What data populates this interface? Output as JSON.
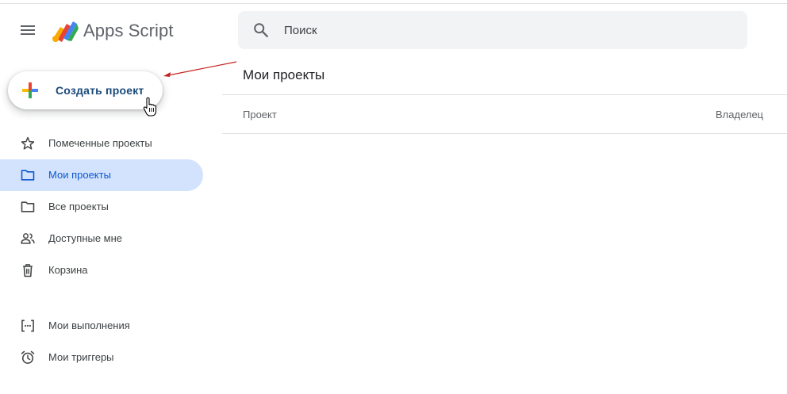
{
  "header": {
    "app_title": "Apps Script",
    "menu_icon": "hamburger-menu-icon",
    "logo_icon": "apps-script-logo",
    "search": {
      "placeholder": "Поиск",
      "value": "",
      "icon": "search-icon"
    }
  },
  "sidebar": {
    "create_button": {
      "label": "Создать проект",
      "icon": "plus-icon"
    },
    "items": [
      {
        "label": "Помеченные проекты",
        "icon": "star-icon",
        "active": false
      },
      {
        "label": "Мои проекты",
        "icon": "folder-icon",
        "active": true
      },
      {
        "label": "Все проекты",
        "icon": "folder-icon",
        "active": false
      },
      {
        "label": "Доступные мне",
        "icon": "people-icon",
        "active": false
      },
      {
        "label": "Корзина",
        "icon": "trash-icon",
        "active": false
      }
    ],
    "secondary_items": [
      {
        "label": "Мои выполнения",
        "icon": "executions-icon"
      },
      {
        "label": "Мои триггеры",
        "icon": "alarm-clock-icon"
      }
    ]
  },
  "main": {
    "title": "Мои проекты",
    "columns": {
      "project": "Проект",
      "owner": "Владелец"
    }
  },
  "colors": {
    "active_bg": "#d3e3fd",
    "active_text": "#0b57d0",
    "annotation_arrow": "#c5221f"
  }
}
